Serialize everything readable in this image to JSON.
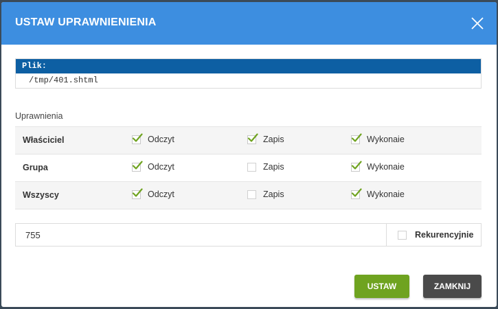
{
  "dialog": {
    "title": "USTAW UPRAWNIENIENIA",
    "close_icon": "close-icon"
  },
  "file": {
    "header": "Plik:",
    "path": "/tmp/401.shtml"
  },
  "permissions": {
    "section_label": "Uprawnienia",
    "rows": [
      {
        "label": "Właściciel",
        "read": {
          "label": "Odczyt",
          "checked": true
        },
        "write": {
          "label": "Zapis",
          "checked": true
        },
        "execute": {
          "label": "Wykonaie",
          "checked": true
        }
      },
      {
        "label": "Grupa",
        "read": {
          "label": "Odczyt",
          "checked": true
        },
        "write": {
          "label": "Zapis",
          "checked": false
        },
        "execute": {
          "label": "Wykonaie",
          "checked": true
        }
      },
      {
        "label": "Wszyscy",
        "read": {
          "label": "Odczyt",
          "checked": true
        },
        "write": {
          "label": "Zapis",
          "checked": false
        },
        "execute": {
          "label": "Wykonaie",
          "checked": true
        }
      }
    ]
  },
  "mode": {
    "value": "755",
    "recursive_label": "Rekurencyjnie",
    "recursive_checked": false
  },
  "buttons": {
    "set": "USTAW",
    "close": "ZAMKNIJ"
  },
  "colors": {
    "titlebar": "#3d8ee0",
    "file_header": "#0d5fa3",
    "checkmark": "#6fa320",
    "set_button": "#6fa320",
    "close_button": "#4a4a4a"
  }
}
